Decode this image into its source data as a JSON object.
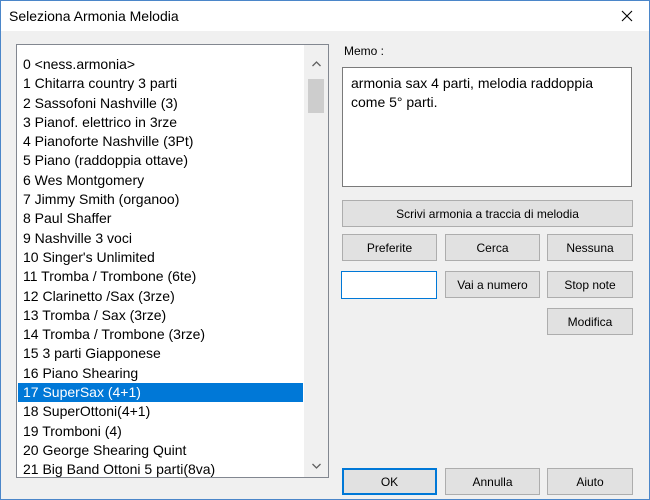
{
  "window": {
    "title": "Seleziona Armonia Melodia"
  },
  "harmony_list": {
    "items": [
      "0 <ness.armonia>",
      "1 Chitarra country 3 parti",
      "2 Sassofoni Nashville (3)",
      "3 Pianof. elettrico in 3rze",
      "4 Pianoforte Nashville (3Pt)",
      "5 Piano (raddoppia ottave)",
      "6 Wes Montgomery",
      "7 Jimmy Smith (organoo)",
      "8 Paul Shaffer",
      "9 Nashville 3 voci",
      "10 Singer's Unlimited",
      "11 Tromba / Trombone (6te)",
      "12 Clarinetto /Sax (3rze)",
      "13 Tromba / Sax (3rze)",
      "14 Tromba / Trombone (3rze)",
      "15 3 parti Giapponese",
      "16 Piano Shearing",
      "17 SuperSax (4+1)",
      "18 SuperOttoni(4+1)",
      "19 Tromboni (4)",
      "20 George Shearing Quint",
      "21 Big Band Ottoni 5 parti(8va)"
    ],
    "selected_index": 17
  },
  "memo": {
    "label": "Memo :",
    "text": "armonia sax 4 parti, melodia raddoppia come 5° parti."
  },
  "buttons": {
    "write_harmony": "Scrivi armonia a traccia di melodia",
    "favorites": "Preferite",
    "search": "Cerca",
    "none": "Nessuna",
    "goto_number": "Vai a numero",
    "stop_notes": "Stop note",
    "edit": "Modifica",
    "ok": "OK",
    "cancel": "Annulla",
    "help": "Aiuto"
  },
  "number_input": {
    "value": ""
  },
  "colors": {
    "selection": "#0078d7",
    "window_border": "#4b86c9",
    "dialog_bg": "#f0f0f0"
  },
  "icons": {
    "close": "close-icon",
    "scroll_up": "chevron-up-icon",
    "scroll_down": "chevron-down-icon"
  }
}
